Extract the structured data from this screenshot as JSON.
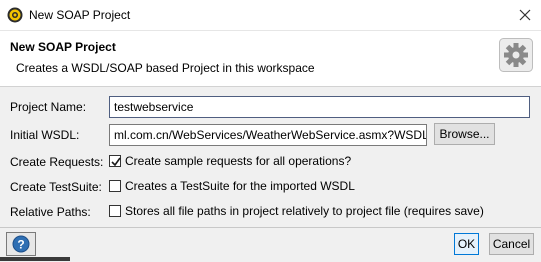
{
  "window": {
    "title": "New SOAP Project",
    "icon": "soapui-icon",
    "close_icon": "close-icon"
  },
  "header": {
    "title": "New SOAP Project",
    "description": "Creates a WSDL/SOAP based Project in this workspace",
    "icon": "gear-icon"
  },
  "form": {
    "project_name": {
      "label": "Project Name:",
      "value": "testwebservice"
    },
    "initial_wsdl": {
      "label": "Initial WSDL:",
      "value": "ml.com.cn/WebServices/WeatherWebService.asmx?WSDL",
      "button_label": "Browse..."
    },
    "create_requests": {
      "label": "Create Requests:",
      "checked": true,
      "text": "Create sample requests for all operations?"
    },
    "create_testsuite": {
      "label": "Create TestSuite:",
      "checked": false,
      "text": "Creates a TestSuite for the imported WSDL"
    },
    "relative_paths": {
      "label": "Relative Paths:",
      "checked": false,
      "text": "Stores all file paths in project relatively to project file (requires save)"
    }
  },
  "footer": {
    "help_icon": "help-icon",
    "ok_label": "OK",
    "cancel_label": "Cancel"
  },
  "colors": {
    "accent": "#0078d7",
    "help_blue": "#2f6fb3",
    "body_bg": "#f0f0f0"
  }
}
